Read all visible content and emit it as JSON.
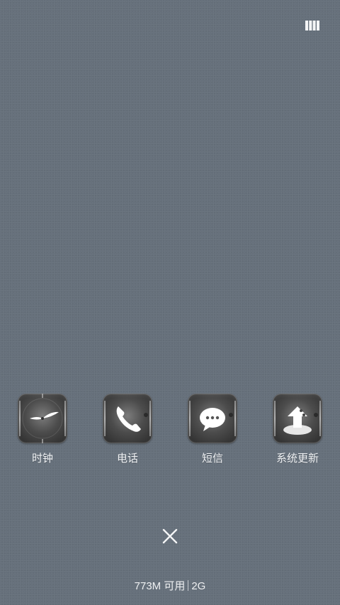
{
  "recent_apps": [
    {
      "label": "时钟",
      "icon": "clock-icon"
    },
    {
      "label": "电话",
      "icon": "phone-icon"
    },
    {
      "label": "短信",
      "icon": "message-icon"
    },
    {
      "label": "系统更新",
      "icon": "system-update-icon"
    }
  ],
  "controls": {
    "menu_icon": "panel-toggle-icon",
    "close_icon": "close-icon"
  },
  "memory": {
    "available": "773M 可用",
    "total": "2G"
  },
  "colors": {
    "background": "#66707b",
    "text": "#eef0f2"
  }
}
